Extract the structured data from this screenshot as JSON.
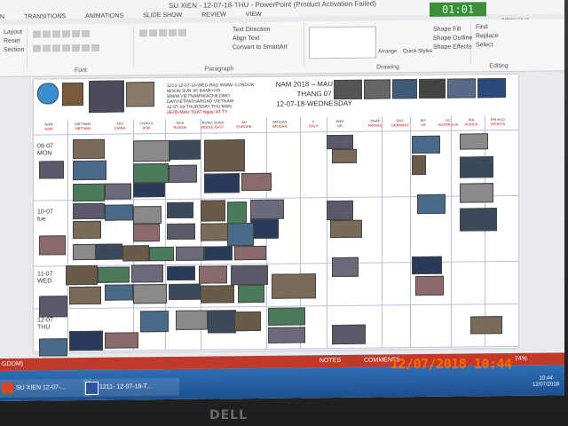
{
  "window": {
    "title": "SU XIEN - 12-07-18-THU - PowerPoint (Product Activation Failed)",
    "tabs": [
      "TRANSITIONS",
      "ANIMATIONS",
      "SLIDE SHOW",
      "REVIEW",
      "VIEW"
    ],
    "left_tab": "N",
    "timer": "01:01",
    "user": "Admin User"
  },
  "ribbon": {
    "layout_label": "Layout",
    "reset_label": "Reset",
    "section_label": "Section",
    "font_group": "Font",
    "paragraph_group": "Paragraph",
    "drawing_group": "Drawing",
    "editing_group": "Editing",
    "text_direction": "Text Direction",
    "align_text": "Align Text",
    "convert_smartart": "Convert to SmartArt",
    "arrange": "Arrange",
    "quick_styles": "Quick Styles",
    "shape_fill": "Shape Fill",
    "shape_outline": "Shape Outline",
    "shape_effects": "Shape Effects",
    "find": "Find",
    "replace": "Replace",
    "select": "Select"
  },
  "slide": {
    "header_lines": [
      "1213-12-07-18-WED-RAD WWW--LONDON",
      "MOON SUN XF BANK+HS",
      "WWW.VIETNAMSKACHILOMO",
      "DAYVIETPATHAROAD VIETNAM",
      "12-07-18-THURSDAY  THU  MAN",
      "26-05-MAU TUAT  Ngay: AT TY"
    ],
    "title_line1": "NAM 2018 – MAU TUAT",
    "title_line2": "THANG 07",
    "title_line3": "12-07-18-WEDNESDAY",
    "columns": [
      {
        "name": "NAM",
        "sub": "NAM"
      },
      {
        "name": "VIETNAM",
        "sub": "VIETNAM"
      },
      {
        "name": "TAU",
        "sub": "CHINA"
      },
      {
        "name": "CHAU A",
        "sub": "ASIA"
      },
      {
        "name": "NGA",
        "sub": "RUSSIA"
      },
      {
        "name": "TRUNG DONG",
        "sub": "MIDDLE EAST"
      },
      {
        "name": "AU",
        "sub": "EUROPE"
      },
      {
        "name": "VATICAN",
        "sub": "VATICAN"
      },
      {
        "name": "Y",
        "sub": "ITALY"
      },
      {
        "name": "ANH",
        "sub": "UK"
      },
      {
        "name": "PHAP",
        "sub": "FRANCE"
      },
      {
        "name": "DUC",
        "sub": "GERMANY"
      },
      {
        "name": "MY",
        "sub": "US"
      },
      {
        "name": "UC",
        "sub": "AUSTRALIA"
      },
      {
        "name": "PHI",
        "sub": "AFRICA"
      },
      {
        "name": "PHI HOC",
        "sub": "SPORTS"
      }
    ],
    "days": [
      {
        "date": "09-07",
        "dow": "MON"
      },
      {
        "date": "10-07",
        "dow": "tue"
      },
      {
        "date": "11-07",
        "dow": "WED"
      },
      {
        "date": "12-07",
        "dow": "THU"
      }
    ]
  },
  "statusbar": {
    "left": "GDOM)",
    "notes": "NOTES",
    "comments": "COMMENTS",
    "zoom": "74%"
  },
  "taskbar": {
    "items": [
      "SU XIEN 12-07-...",
      "1211- 12-07-18-T..."
    ],
    "time": "10:44",
    "date": "12/07/2018"
  },
  "camera_stamp": "12/07/2018  10:44",
  "brand": "DELL"
}
